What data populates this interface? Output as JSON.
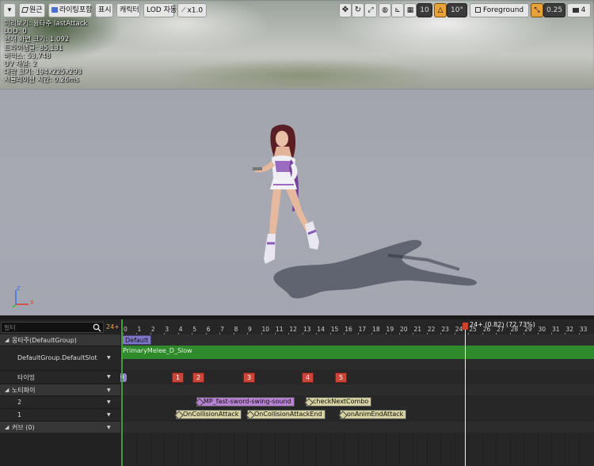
{
  "toolbar": {
    "menu_label": "▾",
    "perspective_label": "원근",
    "lighting_label": "라이팅포함",
    "show_label": "표시",
    "character_label": "캐릭터",
    "lod_label": "LOD 자동",
    "speed_label": "x1.0",
    "grid_snap_value": "10",
    "rotate_snap_value": "10°",
    "layer_label": "Foreground",
    "scale_snap_value": "0.25",
    "camera_speed_value": "4"
  },
  "stats": [
    "미리보기: 융타주 lastAttack",
    "LOD: 0",
    "현재 화면 크기: 1.092",
    "트라이앵글: 85,131",
    "버텍스: 53,748",
    "UV 채널: 2",
    "대략 크기: 194x225x293",
    "시뮬레이션 시간: 0.26ms"
  ],
  "axis": {
    "z": "Z",
    "x": "X"
  },
  "filter": {
    "placeholder": "필터",
    "frame_count": "24+"
  },
  "tracks": {
    "montage_group": "몽타주(DefaultGroup)",
    "slot": "DefaultGroup.DefaultSlot",
    "timing": "타이밍",
    "notifies": "노티파이",
    "notify_track_2": "2",
    "notify_track_1": "1",
    "curves": "커브 (0)"
  },
  "timeline": {
    "ticks": [
      "0",
      "1",
      "2",
      "3",
      "4",
      "5",
      "6",
      "7",
      "8",
      "9",
      "10",
      "11",
      "12",
      "13",
      "14",
      "15",
      "16",
      "17",
      "18",
      "19",
      "20",
      "21",
      "22",
      "23",
      "24",
      "25",
      "26",
      "27",
      "28",
      "29",
      "30",
      "31",
      "32",
      "33"
    ],
    "scrub_label": "24+ (0.82) (72.73%)",
    "section_name": "Default",
    "slot_animation": "PrimaryMelee_D_Slow",
    "section_start": "0",
    "timing_markers": [
      "1",
      "2",
      "3",
      "4",
      "5"
    ],
    "notifies_track2": [
      "MP_fast-sword-swing-sound",
      "checkNextCombo"
    ],
    "notifies_track1": [
      "OnCollisionAttack",
      "OnCollisionAttackEnd",
      "onAnimEndAttack"
    ]
  },
  "colors": {
    "slot_green": "#2e8a2a",
    "section_red": "#c9463a",
    "notify_purple": "#b882d4",
    "notify_beige": "#d6d1a0",
    "section_tag": "#7f77c8",
    "accent_orange": "#e8a23a"
  }
}
